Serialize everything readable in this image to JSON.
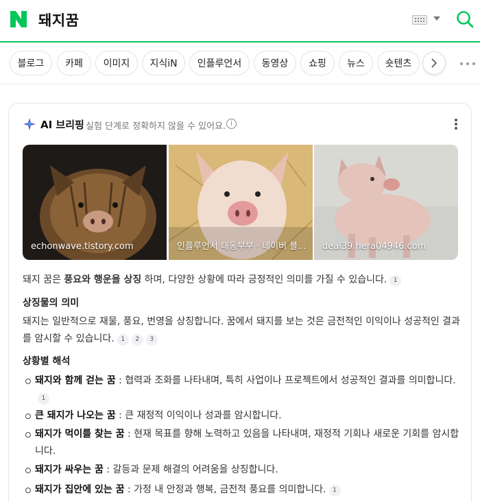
{
  "header": {
    "query": "돼지꿈"
  },
  "tabs": [
    {
      "label": "블로그"
    },
    {
      "label": "카페"
    },
    {
      "label": "이미지"
    },
    {
      "label": "지식iN"
    },
    {
      "label": "인플루언서"
    },
    {
      "label": "동영상"
    },
    {
      "label": "쇼핑"
    },
    {
      "label": "뉴스"
    },
    {
      "label": "숏텐츠"
    }
  ],
  "ai": {
    "title": "AI 브리핑",
    "disclaimer": "실험 단계로 정확하지 않을 수 있어요.",
    "images": [
      {
        "source": "echonwave.tistory.com"
      },
      {
        "source": "인플루언서 태동부부 · 네이버 블..."
      },
      {
        "source": "deal39.hera04946.com"
      }
    ],
    "summary": {
      "pre": "돼지 꿈은 ",
      "bold": "풍요와 행운을 상징",
      "post": " 하며, 다양한 상황에 따라 긍정적인 의미를 가질 수 있습니다.",
      "refs": [
        "1"
      ]
    },
    "section1": {
      "title": "상징물의 의미",
      "text": "돼지는 일반적으로 재물, 풍요, 번영을 상징합니다. 꿈에서 돼지를 보는 것은 금전적인 이익이나 성공적인 결과를 암시할 수 있습니다.",
      "refs": [
        "1",
        "2",
        "3"
      ]
    },
    "section2": {
      "title": "상황별 해석",
      "items": [
        {
          "term": "돼지와 함께 걷는 꿈",
          "desc": " : 협력과 조화를 나타내며, 특히 사업이나 프로젝트에서 성공적인 결과를 의미합니다.",
          "ref": "1"
        },
        {
          "term": "큰 돼지가 나오는 꿈",
          "desc": " : 큰 재정적 이익이나 성과를 암시합니다.",
          "ref": ""
        },
        {
          "term": "돼지가 먹이를 찾는 꿈",
          "desc": " : 현재 목표를 향해 노력하고 있음을 나타내며, 재정적 기회나 새로운 기회를 암시합니다.",
          "ref": ""
        },
        {
          "term": "돼지가 싸우는 꿈",
          "desc": " : 갈등과 문제 해결의 어려움을 상징합니다.",
          "ref": ""
        },
        {
          "term": "돼지가 집안에 있는 꿈",
          "desc": " : 가정 내 안정과 행복, 금전적 풍요를 의미합니다.",
          "ref": "1"
        }
      ]
    }
  },
  "colors": {
    "brand_green": "#03c75a"
  }
}
